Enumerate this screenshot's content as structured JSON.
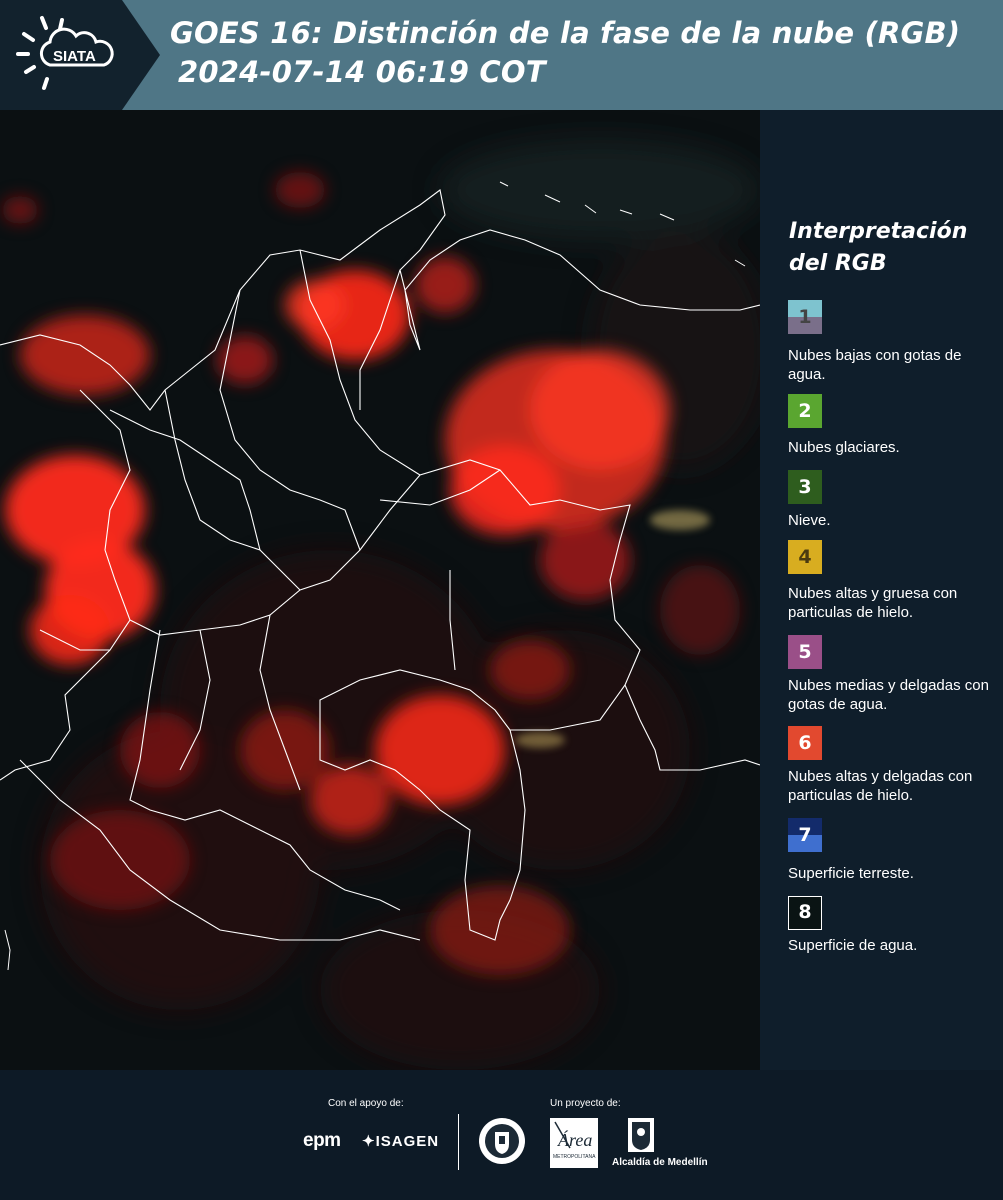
{
  "header": {
    "logo_text": "SIATA",
    "title_line1": "GOES 16: Distinción de la fase de la nube (RGB)",
    "title_line2": "2024-07-14 06:19 COT"
  },
  "legend": {
    "title": "Interpretación del RGB",
    "items": [
      {
        "number": "1",
        "label": "Nubes bajas con gotas de agua.",
        "colors": [
          "#7ec3cf",
          "#7a6f8a"
        ]
      },
      {
        "number": "2",
        "label": "Nubes glaciares.",
        "colors": [
          "#5aa630"
        ]
      },
      {
        "number": "3",
        "label": "Nieve.",
        "colors": [
          "#2e5d1e"
        ]
      },
      {
        "number": "4",
        "label": "Nubes altas y gruesa con particulas de hielo.",
        "colors": [
          "#d8ad20"
        ]
      },
      {
        "number": "5",
        "label": "Nubes medias y delgadas con gotas de agua.",
        "colors": [
          "#9a4f88"
        ]
      },
      {
        "number": "6",
        "label": "Nubes altas y delgadas con particulas de hielo.",
        "colors": [
          "#e2492f"
        ]
      },
      {
        "number": "7",
        "label": "Superficie terreste.",
        "colors": [
          "#132b6b",
          "#3f6fcf"
        ]
      },
      {
        "number": "8",
        "label": "Superficie de agua.",
        "colors": [
          "#0a1414"
        ]
      }
    ]
  },
  "footer": {
    "support_caption": "Con el apoyo de:",
    "project_caption": "Un proyecto de:",
    "sponsor_1": "epm",
    "sponsor_2": "ISAGEN",
    "partner_area": "Área",
    "partner_area_sub": "METROPOLITANA",
    "partner_alcaldia": "Alcaldía de Medellín"
  },
  "colors": {
    "header_bg": "#4f7686",
    "legend_bg": "#0f1e2b",
    "footer_bg": "#0d1a26",
    "cloud_red": "#ff2a1a"
  }
}
